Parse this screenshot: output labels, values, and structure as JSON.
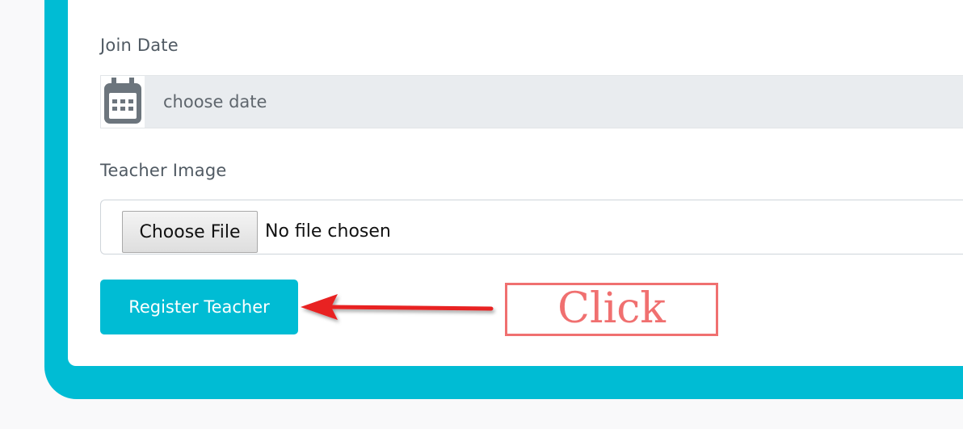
{
  "form": {
    "join_date": {
      "label": "Join Date",
      "placeholder": "choose date",
      "icon": "calendar-icon"
    },
    "teacher_image": {
      "label": "Teacher Image",
      "choose_file_label": "Choose File",
      "no_file_text": "No file chosen"
    },
    "submit_label": "Register Teacher"
  },
  "annotation": {
    "callout_text": "Click",
    "arrow_color": "#e82020",
    "callout_color": "#f07070"
  },
  "colors": {
    "accent": "#00bcd4",
    "input_addon_bg": "#e9ecef"
  }
}
